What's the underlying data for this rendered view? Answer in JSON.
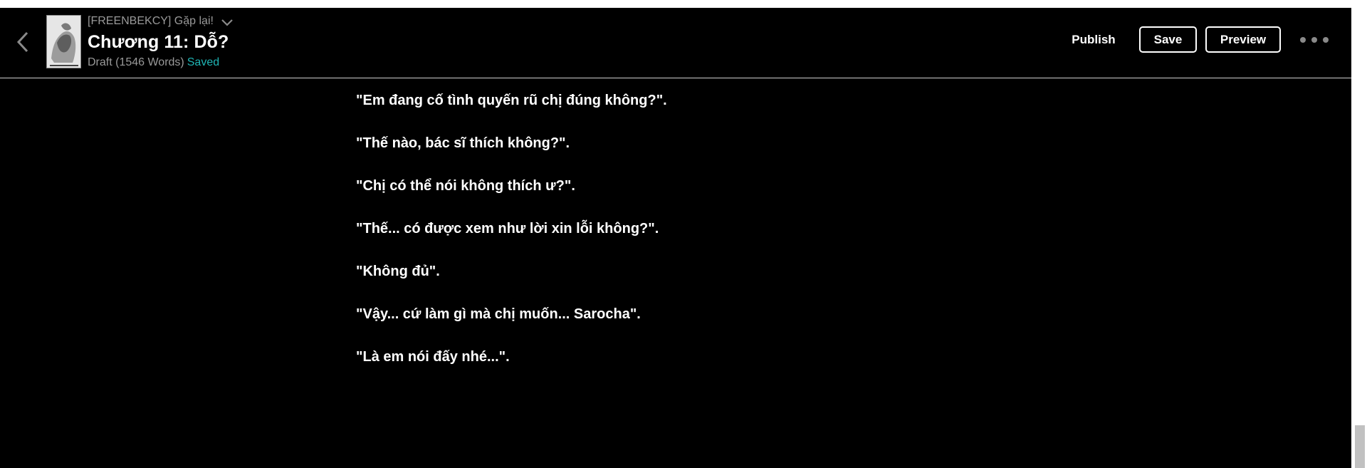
{
  "header": {
    "story_title": "[FREENBEKCY] Gặp lại!",
    "chapter_title": "Chương 11: Dỗ?",
    "status_draft": "Draft (1546 Words)",
    "status_saved": "Saved",
    "publish_label": "Publish",
    "save_label": "Save",
    "preview_label": "Preview"
  },
  "content": {
    "paragraphs": [
      "\"Em đang cố tình quyến rũ chị đúng không?\".",
      "\"Thế nào, bác sĩ thích không?\".",
      "\"Chị có thể nói không thích ư?\".",
      "\"Thế... có được xem như lời xin lỗi không?\".",
      "\"Không đủ\".",
      "\"Vậy... cứ làm gì mà chị muốn... Sarocha\".",
      "\"Là em nói đấy nhé...\"."
    ]
  },
  "colors": {
    "background": "#000000",
    "saved_accent": "#1fb4b4",
    "muted_text": "#9a9a9a"
  },
  "icons": [
    "back-arrow-icon",
    "chevron-down-icon",
    "more-options-icon"
  ]
}
